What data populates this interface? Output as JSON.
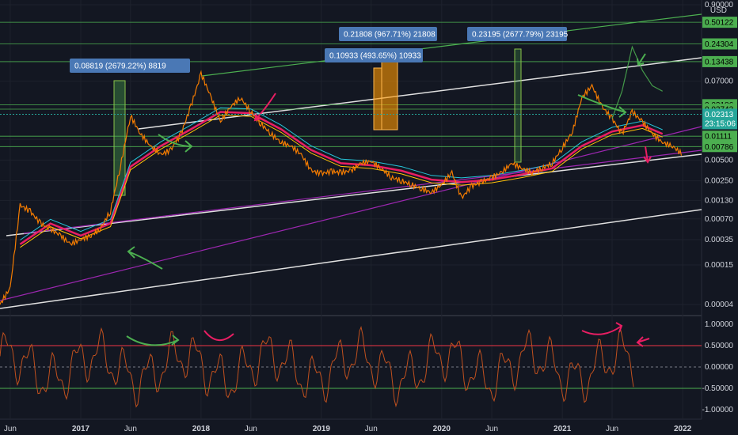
{
  "chart_data": [
    {
      "type": "line",
      "title": "",
      "scale": "log",
      "currency_label": "USD",
      "y_ticks": [
        {
          "label": "0.90000",
          "value": 0.9
        },
        {
          "label": "0.07000",
          "value": 0.07
        },
        {
          "label": "0.01000",
          "value": 0.01
        },
        {
          "label": "0.00500",
          "value": 0.005
        },
        {
          "label": "0.00250",
          "value": 0.0025
        },
        {
          "label": "0.00130",
          "value": 0.0013
        },
        {
          "label": "0.00070",
          "value": 0.0007
        },
        {
          "label": "0.00035",
          "value": 0.00035
        },
        {
          "label": "0.00015",
          "value": 0.00015
        },
        {
          "label": "0.00004",
          "value": 4e-05
        }
      ],
      "x_ticks": [
        {
          "label": "Jun",
          "date": "2016-06"
        },
        {
          "label": "2017",
          "date": "2017-01",
          "bold": true
        },
        {
          "label": "Jun",
          "date": "2017-06"
        },
        {
          "label": "2018",
          "date": "2018-01",
          "bold": true
        },
        {
          "label": "Jun",
          "date": "2018-06"
        },
        {
          "label": "2019",
          "date": "2019-01",
          "bold": true
        },
        {
          "label": "Jun",
          "date": "2019-06"
        },
        {
          "label": "2020",
          "date": "2020-01",
          "bold": true
        },
        {
          "label": "Jun",
          "date": "2020-06"
        },
        {
          "label": "2021",
          "date": "2021-01",
          "bold": true
        },
        {
          "label": "Jun",
          "date": "2021-06"
        },
        {
          "label": "2022",
          "date": "2022-01",
          "bold": true
        }
      ],
      "price_tags": [
        {
          "label": "0.50122",
          "value": 0.50122,
          "color": "#4caf50"
        },
        {
          "label": "0.24304",
          "value": 0.24304,
          "color": "#4caf50"
        },
        {
          "label": "0.13438",
          "value": 0.13438,
          "color": "#4caf50"
        },
        {
          "label": "0.03186",
          "value": 0.03186,
          "color": "#4caf50"
        },
        {
          "label": "0.02743",
          "value": 0.02743,
          "color": "#4caf50"
        },
        {
          "label": "0.01111",
          "value": 0.01111,
          "color": "#4caf50"
        },
        {
          "label": "0.00786",
          "value": 0.00786,
          "color": "#4caf50"
        }
      ],
      "current_price": {
        "label": "0.02313",
        "countdown": "23:15:06",
        "value": 0.02313,
        "color": "#26a69a"
      },
      "measure_labels": [
        "0.08819 (2679.22%) 8819",
        "0.21808 (967.71%) 21808",
        "0.10933 (493.65%) 10933",
        "0.23195 (2677.79%) 23195"
      ],
      "price_path": [
        [
          "2016-05",
          4e-05
        ],
        [
          "2016-06",
          7e-05
        ],
        [
          "2016-07",
          0.0011
        ],
        [
          "2016-08",
          0.0009
        ],
        [
          "2016-09",
          0.0006
        ],
        [
          "2016-10",
          0.0005
        ],
        [
          "2016-11",
          0.0004
        ],
        [
          "2016-12",
          0.0003
        ],
        [
          "2017-01",
          0.00035
        ],
        [
          "2017-02",
          0.0004
        ],
        [
          "2017-03",
          0.0005
        ],
        [
          "2017-04",
          0.0009
        ],
        [
          "2017-05",
          0.004
        ],
        [
          "2017-06",
          0.022
        ],
        [
          "2017-07",
          0.012
        ],
        [
          "2017-08",
          0.008
        ],
        [
          "2017-09",
          0.006
        ],
        [
          "2017-10",
          0.007
        ],
        [
          "2017-11",
          0.012
        ],
        [
          "2017-12",
          0.03
        ],
        [
          "2018-01",
          0.09
        ],
        [
          "2018-02",
          0.04
        ],
        [
          "2018-03",
          0.018
        ],
        [
          "2018-04",
          0.03
        ],
        [
          "2018-05",
          0.04
        ],
        [
          "2018-06",
          0.025
        ],
        [
          "2018-07",
          0.017
        ],
        [
          "2018-08",
          0.012
        ],
        [
          "2018-09",
          0.009
        ],
        [
          "2018-10",
          0.008
        ],
        [
          "2018-11",
          0.006
        ],
        [
          "2018-12",
          0.0035
        ],
        [
          "2019-01",
          0.0032
        ],
        [
          "2019-02",
          0.0034
        ],
        [
          "2019-03",
          0.0033
        ],
        [
          "2019-04",
          0.0035
        ],
        [
          "2019-05",
          0.0045
        ],
        [
          "2019-06",
          0.0048
        ],
        [
          "2019-07",
          0.0038
        ],
        [
          "2019-08",
          0.0028
        ],
        [
          "2019-09",
          0.0025
        ],
        [
          "2019-10",
          0.0022
        ],
        [
          "2019-11",
          0.0019
        ],
        [
          "2019-12",
          0.0017
        ],
        [
          "2020-01",
          0.0022
        ],
        [
          "2020-02",
          0.0033
        ],
        [
          "2020-03",
          0.0014
        ],
        [
          "2020-04",
          0.0021
        ],
        [
          "2020-05",
          0.0024
        ],
        [
          "2020-06",
          0.0028
        ],
        [
          "2020-07",
          0.0033
        ],
        [
          "2020-08",
          0.0045
        ],
        [
          "2020-09",
          0.0038
        ],
        [
          "2020-10",
          0.0033
        ],
        [
          "2020-11",
          0.0038
        ],
        [
          "2020-12",
          0.0045
        ],
        [
          "2021-01",
          0.0075
        ],
        [
          "2021-02",
          0.013
        ],
        [
          "2021-03",
          0.04
        ],
        [
          "2021-04",
          0.06
        ],
        [
          "2021-05",
          0.03
        ],
        [
          "2021-06",
          0.02
        ],
        [
          "2021-07",
          0.012
        ],
        [
          "2021-08",
          0.025
        ],
        [
          "2021-09",
          0.018
        ],
        [
          "2021-10",
          0.012
        ],
        [
          "2021-11",
          0.009
        ],
        [
          "2021-12",
          0.008
        ],
        [
          "2022-01",
          0.006
        ]
      ],
      "ma_path": [
        [
          "2016-07",
          0.0003
        ],
        [
          "2016-10",
          0.0006
        ],
        [
          "2017-01",
          0.0004
        ],
        [
          "2017-04",
          0.0006
        ],
        [
          "2017-06",
          0.004
        ],
        [
          "2017-09",
          0.008
        ],
        [
          "2017-12",
          0.014
        ],
        [
          "2018-03",
          0.025
        ],
        [
          "2018-06",
          0.024
        ],
        [
          "2018-09",
          0.014
        ],
        [
          "2018-12",
          0.007
        ],
        [
          "2019-03",
          0.0045
        ],
        [
          "2019-06",
          0.0042
        ],
        [
          "2019-09",
          0.0035
        ],
        [
          "2019-12",
          0.0026
        ],
        [
          "2020-03",
          0.0024
        ],
        [
          "2020-06",
          0.0026
        ],
        [
          "2020-09",
          0.0031
        ],
        [
          "2020-12",
          0.0038
        ],
        [
          "2021-03",
          0.008
        ],
        [
          "2021-06",
          0.013
        ],
        [
          "2021-09",
          0.016
        ],
        [
          "2021-11",
          0.012
        ]
      ],
      "speculative_path": [
        [
          "2021-06",
          0.02
        ],
        [
          "2021-07",
          0.05
        ],
        [
          "2021-08",
          0.22
        ],
        [
          "2021-09",
          0.1
        ],
        [
          "2021-10",
          0.06
        ],
        [
          "2021-11",
          0.05
        ]
      ]
    },
    {
      "type": "line",
      "title": "",
      "y_ticks": [
        {
          "label": "1.00000",
          "value": 1.0
        },
        {
          "label": "0.50000",
          "value": 0.5
        },
        {
          "label": "0.00000",
          "value": 0.0
        },
        {
          "label": "-0.50000",
          "value": -0.5
        },
        {
          "label": "-1.00000",
          "value": -1.0
        }
      ],
      "upper_level": 0.5,
      "lower_level": -0.5
    }
  ]
}
